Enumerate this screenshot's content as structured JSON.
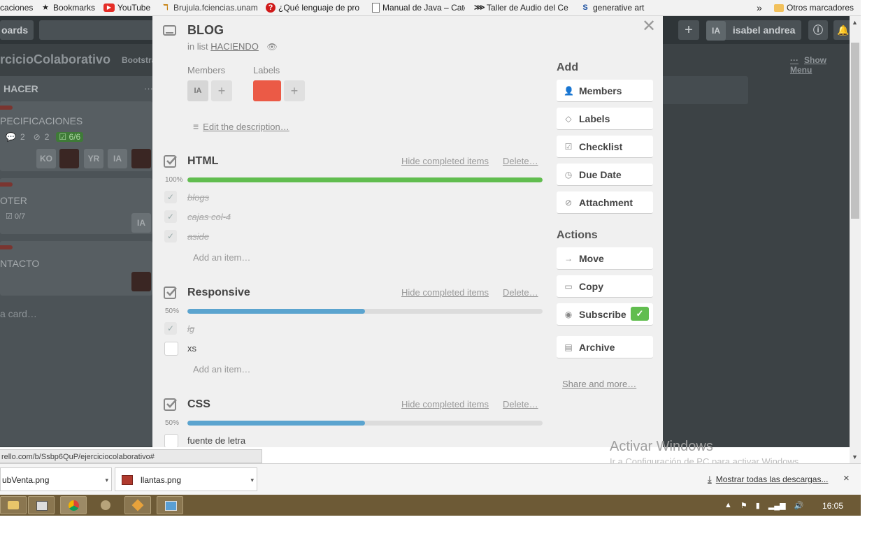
{
  "bookmarks": {
    "items": [
      {
        "label": "caciones",
        "icon": "page-icon"
      },
      {
        "label": "Bookmarks",
        "icon": "star-icon"
      },
      {
        "label": "YouTube",
        "icon": "youtube-icon"
      },
      {
        "label": "Brujula.fciencias.unam",
        "icon": "site-icon"
      },
      {
        "label": "¿Qué lenguaje de pro",
        "icon": "question-icon"
      },
      {
        "label": "Manual de Java – Cate",
        "icon": "page-icon"
      },
      {
        "label": "Taller de Audio del Ce",
        "icon": "site-icon"
      },
      {
        "label": "generative art",
        "icon": "site-icon"
      }
    ],
    "overflow": "»",
    "other": "Otros marcadores"
  },
  "board": {
    "boards_btn": "oards",
    "title": "rcicioColaborativo",
    "subtitle": "Bootstra",
    "user_initials": "IA",
    "user_name": "isabel andrea",
    "show_menu": "Show Menu",
    "list_title": "HACER",
    "list_menu": "···",
    "cards": [
      {
        "text": "PECIFICACIONES",
        "comments": "2",
        "attachments": "2",
        "checklist": "6/6",
        "members": [
          "KO",
          "YR",
          "IA"
        ]
      },
      {
        "text": "OTER",
        "checklist": "0/7",
        "members": [
          "IA"
        ]
      },
      {
        "text": "NTACTO"
      }
    ],
    "add_card": "a card…"
  },
  "modal": {
    "title": "BLOG",
    "in_list_prefix": "in list",
    "list_name": "HACIENDO",
    "members_label": "Members",
    "labels_label": "Labels",
    "member_initials": "IA",
    "plus": "+",
    "label_color": "#eb5a46",
    "edit_description": "Edit the description…",
    "hide_completed": "Hide completed items",
    "delete": "Delete…",
    "add_item": "Add an item…",
    "checklists": [
      {
        "title": "HTML",
        "percent": "100%",
        "progress": 1.0,
        "bar_color": "#61bd4f",
        "items": [
          {
            "text": "blogs",
            "done": true
          },
          {
            "text": "cajas col-4",
            "done": true
          },
          {
            "text": "aside",
            "done": true
          }
        ]
      },
      {
        "title": "Responsive",
        "percent": "50%",
        "progress": 0.5,
        "bar_color": "#5ba4cf",
        "items": [
          {
            "text": "lg",
            "done": true
          },
          {
            "text": "xs",
            "done": false
          }
        ]
      },
      {
        "title": "CSS",
        "percent": "50%",
        "progress": 0.5,
        "bar_color": "#5ba4cf",
        "items": [
          {
            "text": "fuente de letra",
            "done": false
          }
        ]
      }
    ]
  },
  "sidebar": {
    "add_title": "Add",
    "add_buttons": [
      {
        "label": "Members",
        "icon": "person-icon"
      },
      {
        "label": "Labels",
        "icon": "tag-icon"
      },
      {
        "label": "Checklist",
        "icon": "checklist-icon"
      },
      {
        "label": "Due Date",
        "icon": "clock-icon"
      },
      {
        "label": "Attachment",
        "icon": "paperclip-icon"
      }
    ],
    "actions_title": "Actions",
    "actions": [
      {
        "label": "Move",
        "icon": "arrow-right-icon"
      },
      {
        "label": "Copy",
        "icon": "card-icon"
      },
      {
        "label": "Subscribe",
        "icon": "eye-icon",
        "checked": true
      },
      {
        "label": "Archive",
        "icon": "archive-icon"
      }
    ],
    "share_more": "Share and more…"
  },
  "status_url": "rello.com/b/Ssbp6QuP/ejerciciocolaborativo#",
  "watermark": {
    "line1": "Activar Windows",
    "line2": "Ir a Configuración de PC para activar Windows."
  },
  "downloads": {
    "files": [
      "ubVenta.png",
      "llantas.png"
    ],
    "show_all": "Mostrar todas las descargas...",
    "close": "×"
  },
  "taskbar": {
    "time": "16:05"
  }
}
